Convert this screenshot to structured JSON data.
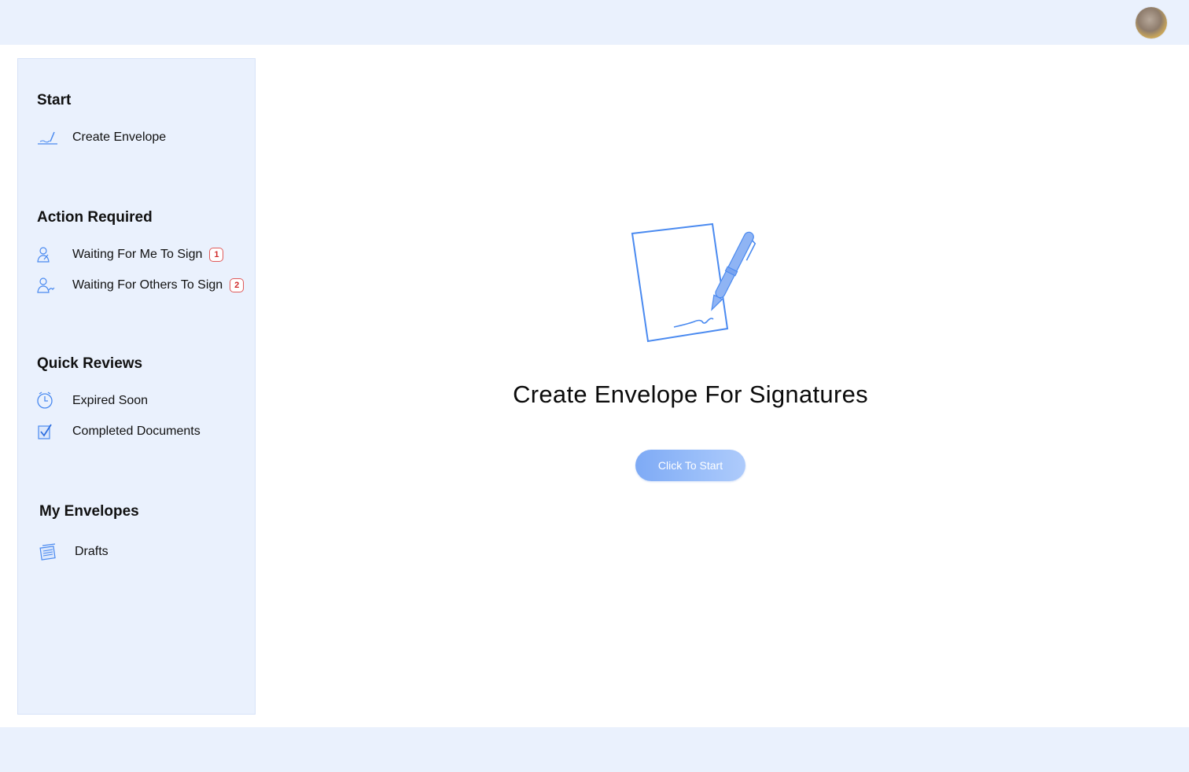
{
  "sidebar": {
    "sections": [
      {
        "title": "Start",
        "items": [
          {
            "label": "Create Envelope",
            "icon": "pen-sign-icon"
          }
        ]
      },
      {
        "title": "Action Required",
        "items": [
          {
            "label": "Waiting For Me To Sign",
            "icon": "user-sign-icon",
            "badge": "1"
          },
          {
            "label": "Waiting For Others To Sign",
            "icon": "users-sign-icon",
            "badge": "2"
          }
        ]
      },
      {
        "title": "Quick Reviews",
        "items": [
          {
            "label": "Expired Soon",
            "icon": "clock-icon"
          },
          {
            "label": "Completed Documents",
            "icon": "checked-document-icon"
          }
        ]
      },
      {
        "title": "My Envelopes",
        "items": [
          {
            "label": "Drafts",
            "icon": "drafts-icon"
          }
        ]
      }
    ]
  },
  "main": {
    "title": "Create Envelope For Signatures",
    "button_label": "Click To Start",
    "illustration_icon": "document-pen-icon"
  },
  "header": {
    "avatar_icon": "cat-avatar"
  },
  "colors": {
    "accent": "#4a8af0",
    "panel": "#eaf1fd",
    "badge_red": "#d02c2c"
  }
}
